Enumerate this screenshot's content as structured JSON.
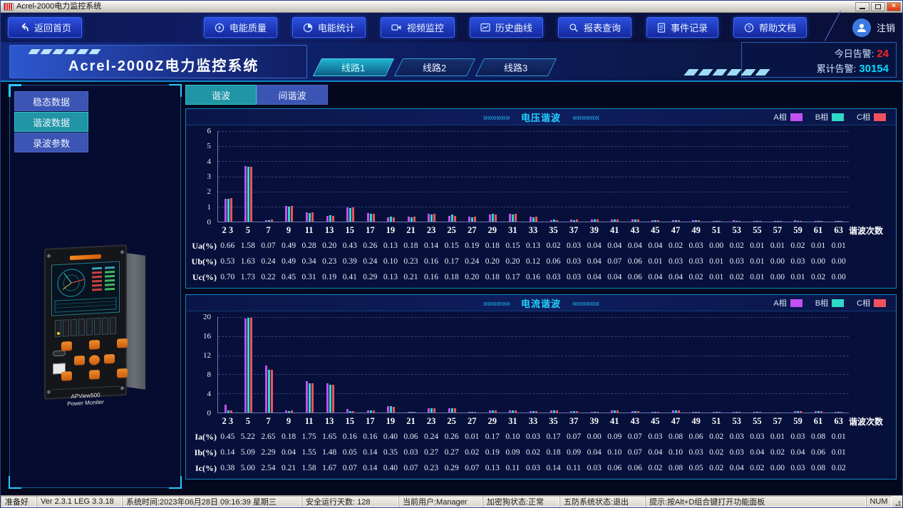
{
  "window": {
    "title": "Acrel-2000电力监控系统",
    "controls": [
      "minimize",
      "maximize",
      "close"
    ]
  },
  "nav": {
    "back_label": "返回首页",
    "logout_label": "注销",
    "buttons": [
      {
        "icon": "power-quality-icon",
        "label": "电能质量"
      },
      {
        "icon": "energy-stats-icon",
        "label": "电能统计"
      },
      {
        "icon": "video-monitor-icon",
        "label": "视频监控"
      },
      {
        "icon": "history-curve-icon",
        "label": "历史曲线"
      },
      {
        "icon": "report-query-icon",
        "label": "报表查询"
      },
      {
        "icon": "event-record-icon",
        "label": "事件记录"
      },
      {
        "icon": "help-doc-icon",
        "label": "帮助文档"
      }
    ]
  },
  "header": {
    "title": "Acrel-2000Z电力监控系统",
    "tabs": [
      {
        "label": "线路1",
        "active": true
      },
      {
        "label": "线路2",
        "active": false
      },
      {
        "label": "线路3",
        "active": false
      }
    ],
    "alarms": {
      "today_label": "今日告警:",
      "today_value": "24",
      "today_color": "#ff2222",
      "total_label": "累计告警:",
      "total_value": "30154",
      "total_color": "#00dcff"
    }
  },
  "sidebar": {
    "items": [
      {
        "label": "稳态数据",
        "active": false
      },
      {
        "label": "谐波数据",
        "active": true
      },
      {
        "label": "录波参数",
        "active": false
      }
    ],
    "device": {
      "model": "APView500",
      "name": "Power Moniter"
    }
  },
  "subtabs": [
    {
      "label": "谐波",
      "active": true
    },
    {
      "label": "间谐波",
      "active": false
    }
  ],
  "legend": [
    {
      "label": "A相",
      "color": "#c44ff2"
    },
    {
      "label": "B相",
      "color": "#2fd9c8"
    },
    {
      "label": "C相",
      "color": "#f2525e"
    }
  ],
  "chart_data": [
    {
      "type": "bar",
      "title": "电压谐波",
      "xlabel": "谐波次数",
      "ylim": [
        0,
        6
      ],
      "yticks": [
        0,
        1,
        2,
        3,
        4,
        5,
        6
      ],
      "grid": true,
      "legend_position": "top-right",
      "categories": [
        "2 3",
        "5",
        "7",
        "9",
        "11",
        "13",
        "15",
        "17",
        "19",
        "21",
        "23",
        "25",
        "27",
        "29",
        "31",
        "33",
        "35",
        "37",
        "39",
        "41",
        "43",
        "45",
        "47",
        "49",
        "51",
        "53",
        "55",
        "57",
        "59",
        "61",
        "63"
      ],
      "series": [
        {
          "name": "A相",
          "color": "#c44ff2",
          "values": [
            1.5,
            3.7,
            0.1,
            1.05,
            0.6,
            0.4,
            0.95,
            0.55,
            0.3,
            0.35,
            0.5,
            0.4,
            0.35,
            0.45,
            0.5,
            0.35,
            0.1,
            0.12,
            0.12,
            0.15,
            0.12,
            0.1,
            0.08,
            0.1,
            0.05,
            0.08,
            0.05,
            0.04,
            0.08,
            0.04,
            0.04
          ]
        },
        {
          "name": "B相",
          "color": "#2fd9c8",
          "values": [
            1.5,
            3.65,
            0.1,
            1.0,
            0.55,
            0.42,
            0.9,
            0.5,
            0.35,
            0.3,
            0.45,
            0.45,
            0.3,
            0.5,
            0.45,
            0.3,
            0.12,
            0.1,
            0.12,
            0.12,
            0.12,
            0.08,
            0.08,
            0.08,
            0.05,
            0.06,
            0.04,
            0.04,
            0.06,
            0.05,
            0.04
          ]
        },
        {
          "name": "C相",
          "color": "#f2525e",
          "values": [
            1.55,
            3.65,
            0.12,
            1.05,
            0.6,
            0.4,
            0.95,
            0.5,
            0.3,
            0.35,
            0.5,
            0.4,
            0.35,
            0.45,
            0.5,
            0.35,
            0.1,
            0.12,
            0.12,
            0.12,
            0.12,
            0.1,
            0.08,
            0.08,
            0.05,
            0.06,
            0.05,
            0.04,
            0.06,
            0.04,
            0.04
          ]
        }
      ],
      "table_rows": [
        {
          "label": "Ua(%)",
          "values": [
            "0.66",
            "1.58",
            "0.07",
            "0.49",
            "0.28",
            "0.20",
            "0.43",
            "0.26",
            "0.13",
            "0.18",
            "0.14",
            "0.15",
            "0.19",
            "0.18",
            "0.15",
            "0.13",
            "0.02",
            "0.03",
            "0.04",
            "0.04",
            "0.04",
            "0.04",
            "0.02",
            "0.03",
            "0.00",
            "0.02",
            "0.01",
            "0.01",
            "0.02",
            "0.01",
            "0.01"
          ]
        },
        {
          "label": "Ub(%)",
          "values": [
            "0.53",
            "1.63",
            "0.24",
            "0.49",
            "0.34",
            "0.23",
            "0.39",
            "0.24",
            "0.10",
            "0.23",
            "0.16",
            "0.17",
            "0.24",
            "0.20",
            "0.20",
            "0.12",
            "0.06",
            "0.03",
            "0.04",
            "0.07",
            "0.06",
            "0.01",
            "0.03",
            "0.03",
            "0.01",
            "0.03",
            "0.01",
            "0.00",
            "0.03",
            "0.00",
            "0.00"
          ]
        },
        {
          "label": "Uc(%)",
          "values": [
            "0.70",
            "1.73",
            "0.22",
            "0.45",
            "0.31",
            "0.19",
            "0.41",
            "0.29",
            "0.13",
            "0.21",
            "0.16",
            "0.18",
            "0.20",
            "0.18",
            "0.17",
            "0.16",
            "0.03",
            "0.03",
            "0.04",
            "0.04",
            "0.06",
            "0.04",
            "0.04",
            "0.02",
            "0.01",
            "0.02",
            "0.01",
            "0.00",
            "0.01",
            "0.02",
            "0.00"
          ]
        }
      ]
    },
    {
      "type": "bar",
      "title": "电流谐波",
      "xlabel": "谐波次数",
      "ylim": [
        0,
        20
      ],
      "yticks": [
        0,
        4,
        8,
        12,
        16,
        20
      ],
      "grid": true,
      "legend_position": "top-right",
      "categories": [
        "2 3",
        "5",
        "7",
        "9",
        "11",
        "13",
        "15",
        "17",
        "19",
        "21",
        "23",
        "25",
        "27",
        "29",
        "31",
        "33",
        "35",
        "37",
        "39",
        "41",
        "43",
        "45",
        "47",
        "49",
        "51",
        "53",
        "55",
        "57",
        "59",
        "61",
        "63"
      ],
      "series": [
        {
          "name": "A相",
          "color": "#c44ff2",
          "values": [
            1.6,
            19.7,
            9.8,
            0.5,
            6.6,
            6.1,
            0.7,
            0.5,
            1.3,
            0.15,
            0.9,
            0.9,
            0.1,
            0.5,
            0.5,
            0.3,
            0.5,
            0.3,
            0.1,
            0.4,
            0.3,
            0.1,
            0.4,
            0.2,
            0.1,
            0.15,
            0.15,
            0.05,
            0.3,
            0.35,
            0.1
          ]
        },
        {
          "name": "B相",
          "color": "#2fd9c8",
          "values": [
            0.4,
            19.9,
            9.0,
            0.3,
            6.1,
            5.8,
            0.3,
            0.4,
            1.3,
            0.1,
            0.9,
            0.85,
            0.1,
            0.5,
            0.5,
            0.3,
            0.5,
            0.3,
            0.1,
            0.4,
            0.3,
            0.1,
            0.4,
            0.2,
            0.1,
            0.15,
            0.15,
            0.05,
            0.3,
            0.35,
            0.1
          ]
        },
        {
          "name": "C相",
          "color": "#f2525e",
          "values": [
            0.5,
            19.8,
            9.0,
            0.4,
            6.1,
            5.8,
            0.3,
            0.4,
            1.2,
            0.1,
            0.9,
            0.85,
            0.1,
            0.5,
            0.5,
            0.3,
            0.5,
            0.3,
            0.1,
            0.4,
            0.3,
            0.1,
            0.4,
            0.2,
            0.1,
            0.15,
            0.15,
            0.05,
            0.3,
            0.35,
            0.1
          ]
        }
      ],
      "table_rows": [
        {
          "label": "Ia(%)",
          "values": [
            "0.45",
            "5.22",
            "2.65",
            "0.18",
            "1.75",
            "1.65",
            "0.16",
            "0.16",
            "0.40",
            "0.06",
            "0.24",
            "0.26",
            "0.01",
            "0.17",
            "0.10",
            "0.03",
            "0.17",
            "0.07",
            "0.00",
            "0.09",
            "0.07",
            "0.03",
            "0.08",
            "0.06",
            "0.02",
            "0.03",
            "0.03",
            "0.01",
            "0.03",
            "0.08",
            "0.01"
          ]
        },
        {
          "label": "Ib(%)",
          "values": [
            "0.14",
            "5.09",
            "2.29",
            "0.04",
            "1.55",
            "1.48",
            "0.05",
            "0.14",
            "0.35",
            "0.03",
            "0.27",
            "0.27",
            "0.02",
            "0.19",
            "0.09",
            "0.02",
            "0.18",
            "0.09",
            "0.04",
            "0.10",
            "0.07",
            "0.04",
            "0.10",
            "0.03",
            "0.02",
            "0.03",
            "0.04",
            "0.02",
            "0.04",
            "0.06",
            "0.01"
          ]
        },
        {
          "label": "Ic(%)",
          "values": [
            "0.38",
            "5.00",
            "2.54",
            "0.21",
            "1.58",
            "1.67",
            "0.07",
            "0.14",
            "0.40",
            "0.07",
            "0.23",
            "0.29",
            "0.07",
            "0.13",
            "0.11",
            "0.03",
            "0.14",
            "0.11",
            "0.03",
            "0.06",
            "0.06",
            "0.02",
            "0.08",
            "0.05",
            "0.02",
            "0.04",
            "0.02",
            "0.00",
            "0.03",
            "0.08",
            "0.02"
          ]
        }
      ]
    }
  ],
  "footer": {
    "sections": [
      "准备好",
      "Ver 2.3.1 LEG 3.3.18",
      "系统时间:2023年06月28日  09:16:39  星期三",
      "安全运行天数: 128",
      "当前用户:Manager",
      "加密狗状态:正常",
      "五防系统状态:退出",
      "提示:按Alt+D组合键打开功能面板"
    ],
    "num": "NUM"
  }
}
